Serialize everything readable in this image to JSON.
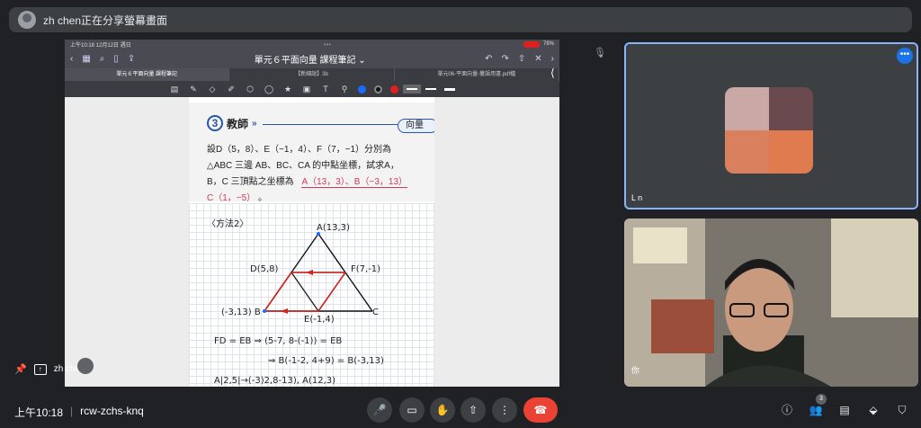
{
  "banner": {
    "text": "zh chen正在分享螢幕畫面"
  },
  "ipad": {
    "status_left": "上午10:18 12月12日 週日",
    "status_right": "78%",
    "doc_title": "單元６平面向量 課程筆記 ⌄",
    "tabs": [
      "單元６平面向量 課程筆記",
      "【新細說】3b",
      "單元06-平面向量-雙語用書.pdf檔"
    ]
  },
  "page": {
    "section_num": "3",
    "section_label": "教師",
    "tag": "向量",
    "problem_lines": [
      "設D（5，8）、E（−1，4）、F（7，−1）分別為",
      "△ABC 三邊 AB、BC、CA 的中點坐標，試求A，",
      "B，C 三頂點之坐標為"
    ],
    "answer1": "A（13，3）、B（−3，13）",
    "answer2": "C（1，−5）",
    "method": "〈方法2〉",
    "labels": {
      "A": "A(13,3)",
      "D": "D(5,8)",
      "F": "F(7,-1)",
      "B": "(-3,13) B",
      "E": "E(-1,4)",
      "C": "C"
    },
    "eq1": "FD = EB ⇒ (5-7, 8-(-1)) = EB",
    "eq2": "⇒ B(-1-2, 4+9) = B(-3,13)",
    "eq3": "A|2,5|→(-3)2,8-13), A(12,3)"
  },
  "tiles": {
    "tile1_name": "L    n",
    "tile2_name": "你"
  },
  "presenter": {
    "name": "zh chen"
  },
  "bottom": {
    "time": "上午10:18",
    "meeting_code": "rcw-zchs-knq",
    "participants_count": "3"
  }
}
